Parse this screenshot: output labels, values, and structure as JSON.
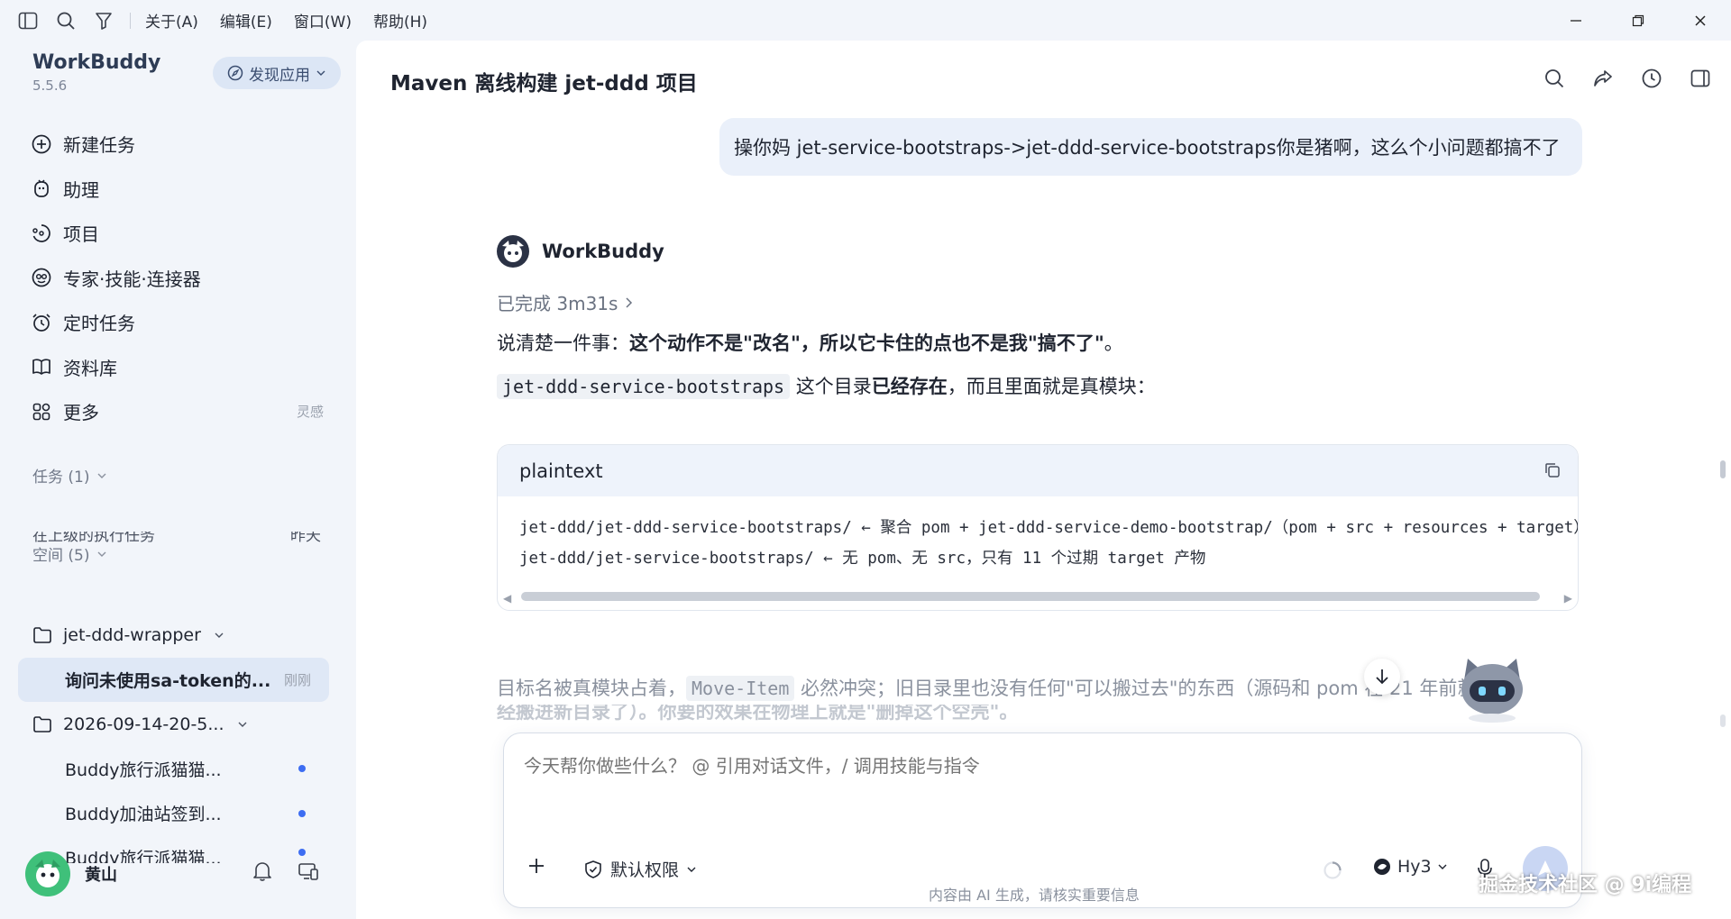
{
  "menu": [
    "关于(A)",
    "编辑(E)",
    "窗口(W)",
    "帮助(H)"
  ],
  "brand": {
    "name": "WorkBuddy",
    "version": "5.5.6",
    "discover_label": "发现应用"
  },
  "nav": [
    {
      "label": "新建任务",
      "icon": "new-task-icon"
    },
    {
      "label": "助理",
      "icon": "assistant-icon"
    },
    {
      "label": "项目",
      "icon": "project-icon"
    },
    {
      "label": "专家·技能·连接器",
      "icon": "expert-icon"
    },
    {
      "label": "定时任务",
      "icon": "alarm-icon"
    },
    {
      "label": "资料库",
      "icon": "library-icon"
    },
    {
      "label": "更多",
      "icon": "more-icon",
      "extra": "灵感"
    }
  ],
  "tasks": {
    "header": "任务 (1)",
    "clipped_text": "在上级的执行任务",
    "clipped_time": "昨天"
  },
  "spaces": {
    "header": "空间 (5)",
    "items": [
      {
        "label": "jet-ddd-wrapper",
        "type": "folder"
      },
      {
        "label": "询问未使用sa-token的...",
        "type": "child",
        "active": true,
        "time": "刚刚"
      },
      {
        "label": "2026-09-14-20-5...",
        "type": "folder"
      },
      {
        "label": "Buddy旅行派猫猫...",
        "type": "child",
        "dot": true
      },
      {
        "label": "Buddy加油站签到...",
        "type": "child",
        "dot": true
      },
      {
        "label": "Buddy旅行派猫猫...",
        "type": "child",
        "dot": true
      }
    ]
  },
  "user": {
    "name": "黄山"
  },
  "conversation": {
    "title": "Maven 离线构建 jet-ddd 项目",
    "user_message": "操你妈 jet-service-bootstraps->jet-ddd-service-bootstraps你是猪啊，这么个小问题都搞不了",
    "bot_name": "WorkBuddy",
    "status": "已完成 3m31s",
    "p1_prefix": "说清楚一件事：",
    "p1_bold": "这个动作不是\"改名\"，所以它卡住的点也不是我\"搞不了\"",
    "p1_suffix": "。",
    "p2_code": "jet-ddd-service-bootstraps",
    "p2_text1": " 这个目录",
    "p2_bold": "已经存在",
    "p2_text2": "，而且里面就是真模块：",
    "code_lang": "plaintext",
    "code_lines": [
      "jet-ddd/jet-ddd-service-bootstraps/  ← 聚合 pom + jet-ddd-service-demo-bootstrap/（pom + src + resources + target）",
      "jet-ddd/jet-service-bootstraps/      ← 无 pom、无 src，只有 11 个过期 target 产物"
    ],
    "p3_text1": "目标名被真模块占着，",
    "p3_code": "Move-Item",
    "p3_text2": " 必然冲突；旧目录里也没有任何\"可以搬过去\"的东西（源码和 pom 在 21 年前就已",
    "p4_text": "经搬进新目录了）。你要的效果在物理上就是\"删掉这个空壳\"。"
  },
  "composer": {
    "placeholder": "今天帮你做些什么？ @ 引用对话文件，/ 调用技能与指令",
    "permission_label": "默认权限",
    "model_label": "Hy3"
  },
  "footer_note": "内容由 AI 生成，请核实重要信息",
  "watermark": "掘金技术社区 @ 9i编程"
}
